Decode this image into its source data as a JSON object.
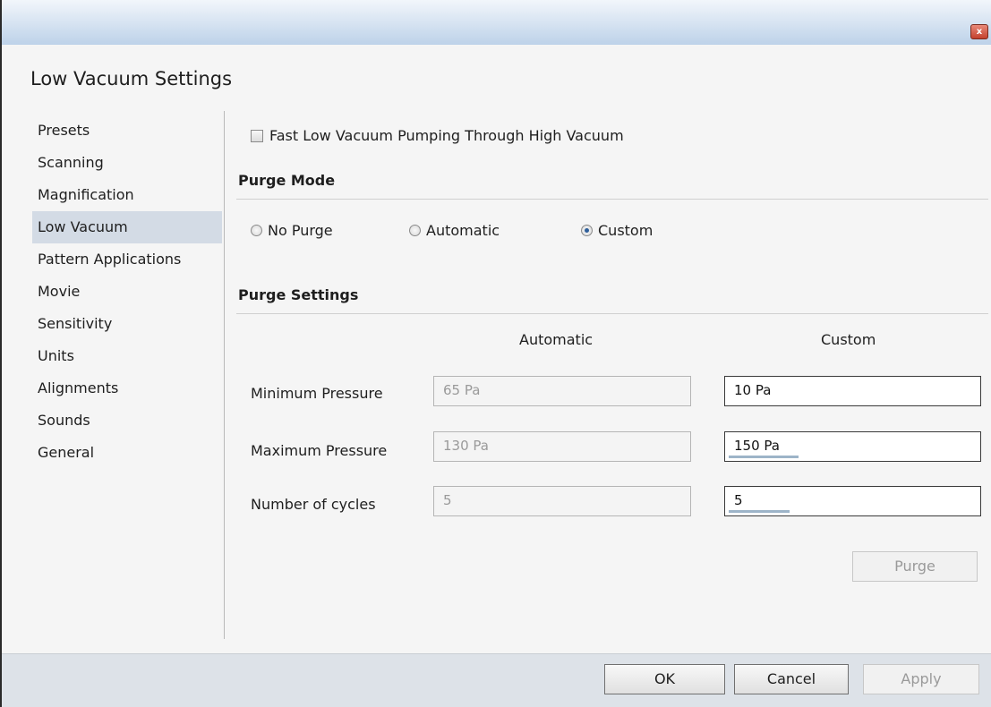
{
  "window": {
    "close_glyph": "x"
  },
  "dialog": {
    "title": "Low Vacuum Settings"
  },
  "nav": {
    "items": [
      {
        "label": "Presets"
      },
      {
        "label": "Scanning"
      },
      {
        "label": "Magnification"
      },
      {
        "label": "Low Vacuum",
        "selected": true
      },
      {
        "label": "Pattern Applications"
      },
      {
        "label": "Movie"
      },
      {
        "label": "Sensitivity"
      },
      {
        "label": "Units"
      },
      {
        "label": "Alignments"
      },
      {
        "label": "Sounds"
      },
      {
        "label": "General"
      }
    ]
  },
  "fast_pumping": {
    "label": "Fast Low Vacuum Pumping Through High Vacuum",
    "checked": false
  },
  "purge_mode": {
    "title": "Purge Mode",
    "options": [
      {
        "label": "No Purge",
        "checked": false
      },
      {
        "label": "Automatic",
        "checked": false
      },
      {
        "label": "Custom",
        "checked": true
      }
    ]
  },
  "purge_settings": {
    "title": "Purge Settings",
    "col_automatic": "Automatic",
    "col_custom": "Custom",
    "rows": [
      {
        "label": "Minimum Pressure",
        "automatic": "65 Pa",
        "custom": "10 Pa"
      },
      {
        "label": "Maximum Pressure",
        "automatic": "130 Pa",
        "custom": "150 Pa"
      },
      {
        "label": "Number of cycles",
        "automatic": "5",
        "custom": "5"
      }
    ],
    "purge_button": "Purge"
  },
  "footer": {
    "ok": "OK",
    "cancel": "Cancel",
    "apply": "Apply"
  }
}
